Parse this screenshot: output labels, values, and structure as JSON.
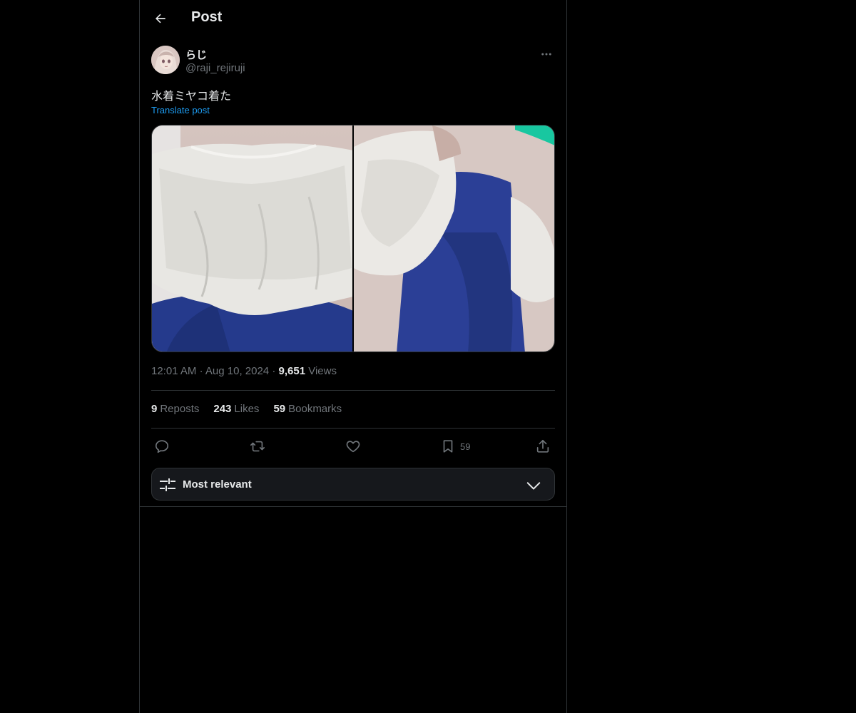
{
  "header": {
    "title": "Post"
  },
  "author": {
    "display_name": "らじ",
    "handle": "@raji_rejiruji"
  },
  "post": {
    "text": "水着ミヤコ着た",
    "translate_label": "Translate post",
    "time": "12:01 AM",
    "date": "Aug 10, 2024",
    "views_count": "9,651",
    "views_label": "Views"
  },
  "stats": {
    "reposts_count": "9",
    "reposts_label": "Reposts",
    "likes_count": "243",
    "likes_label": "Likes",
    "bookmarks_count": "59",
    "bookmarks_label": "Bookmarks"
  },
  "actions": {
    "bookmark_count": "59"
  },
  "sort": {
    "label": "Most relevant"
  },
  "icons": {
    "back": "arrow-left-icon",
    "more": "more-horizontal-icon",
    "reply": "reply-icon",
    "repost": "repost-icon",
    "like": "heart-icon",
    "bookmark": "bookmark-icon",
    "share": "share-icon",
    "sort": "sliders-icon",
    "chevron": "chevron-down-icon"
  },
  "colors": {
    "background": "#000000",
    "text": "#e7e9ea",
    "muted": "#71767b",
    "link": "#1d9bf0",
    "border": "#2f3336"
  }
}
